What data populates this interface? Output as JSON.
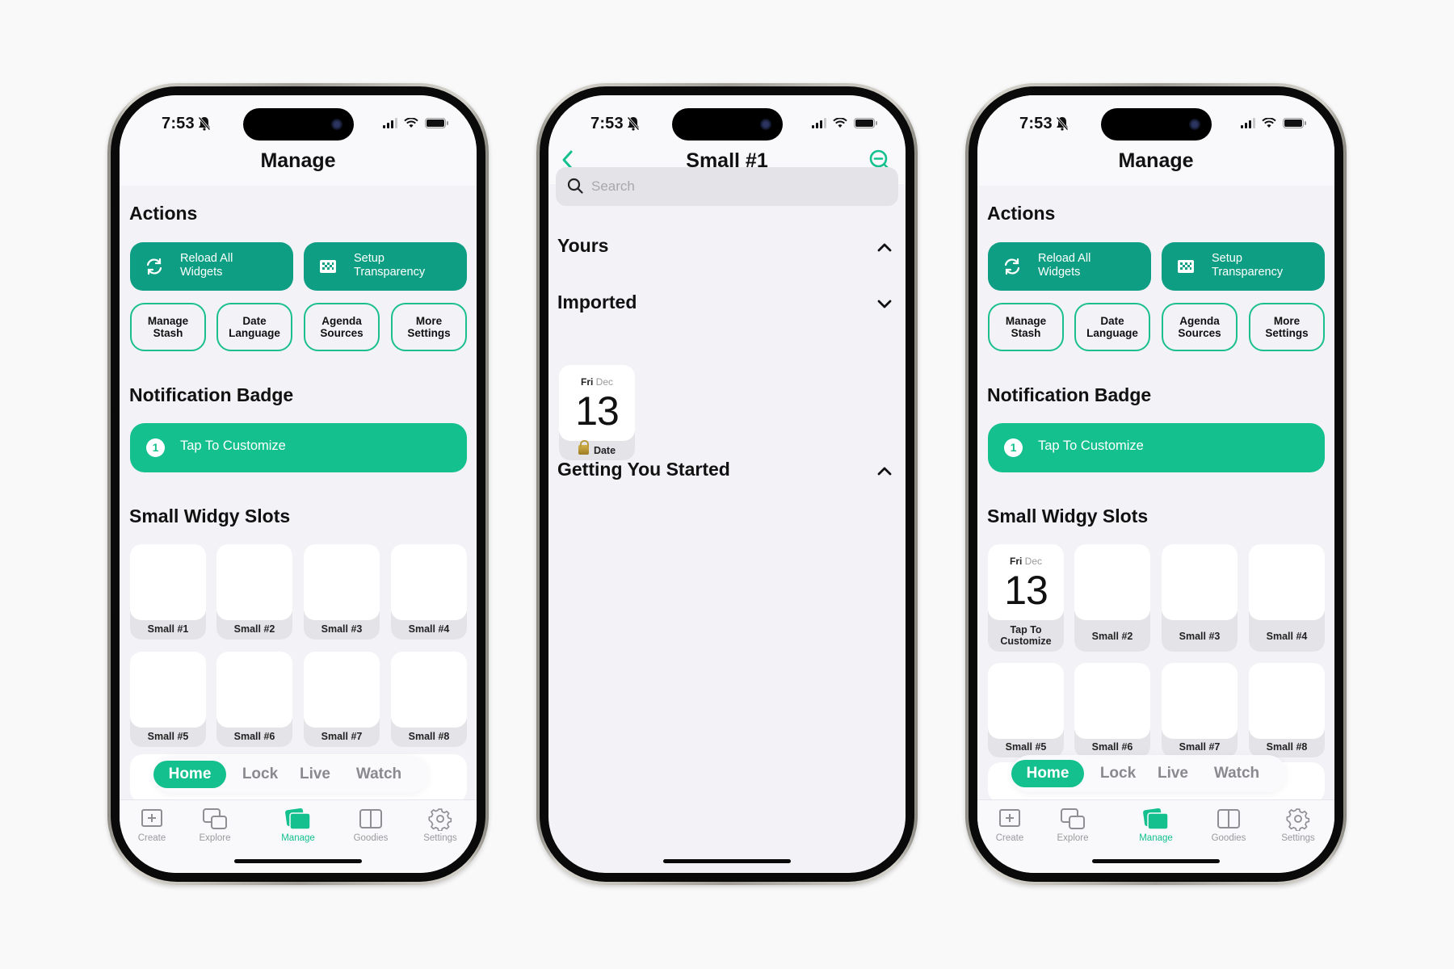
{
  "status_bar": {
    "time": "7:53"
  },
  "manage_screen": {
    "title": "Manage",
    "actions_title": "Actions",
    "primary_actions": [
      {
        "label_line1": "Reload All",
        "label_line2": "Widgets",
        "icon": "arrows-rotate-icon"
      },
      {
        "label_line1": "Setup",
        "label_line2": "Transparency",
        "icon": "checkerboard-icon"
      }
    ],
    "secondary_actions": [
      {
        "label_line1": "Manage",
        "label_line2": "Stash"
      },
      {
        "label_line1": "Date",
        "label_line2": "Language"
      },
      {
        "label_line1": "Agenda",
        "label_line2": "Sources"
      },
      {
        "label_line1": "More",
        "label_line2": "Settings"
      }
    ],
    "badge_title": "Notification Badge",
    "badge_number": "1",
    "badge_label": "Tap To Customize",
    "slots_title": "Small Widgy Slots",
    "slots": [
      "Small #1",
      "Small #2",
      "Small #3",
      "Small #4",
      "Small #5",
      "Small #6",
      "Small #7",
      "Small #8"
    ],
    "segments": [
      {
        "label": "Home",
        "active": true
      },
      {
        "label": "Lock",
        "active": false
      },
      {
        "label": "Live",
        "active": false
      },
      {
        "label": "Watch",
        "active": false
      }
    ],
    "tabs": [
      {
        "label": "Create",
        "icon": "plus-square-icon"
      },
      {
        "label": "Explore",
        "icon": "overlapping-windows-icon"
      },
      {
        "label": "Manage",
        "icon": "stacked-cards-icon",
        "active": true
      },
      {
        "label": "Goodies",
        "icon": "split-panel-icon"
      },
      {
        "label": "Settings",
        "icon": "gear-icon"
      }
    ]
  },
  "filled_slot": {
    "weekday": "Fri",
    "month": "Dec",
    "day": "13",
    "label_line1": "Tap To",
    "label_line2": "Customize"
  },
  "detail_screen": {
    "title": "Small #1",
    "search_placeholder": "Search",
    "sections": [
      {
        "title": "Yours",
        "expanded": true
      },
      {
        "title": "Imported",
        "expanded": false
      },
      {
        "title": "Getting You Started",
        "expanded": true
      }
    ],
    "imported_widget": {
      "weekday": "Fri",
      "month": "Dec",
      "day": "13",
      "label": "Date"
    }
  },
  "colors": {
    "accent": "#13c08e",
    "action_teal": "#0e9e83",
    "background": "#f2f2f7",
    "tab_inactive": "#9a9a9e"
  }
}
